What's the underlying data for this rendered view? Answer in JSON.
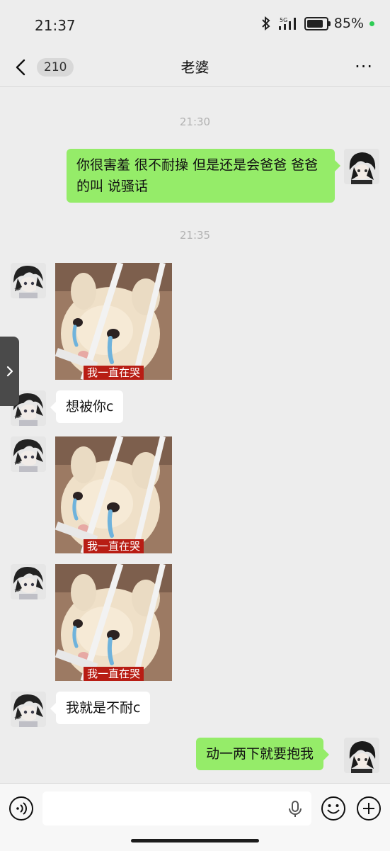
{
  "status": {
    "time": "21:37",
    "network": "5G",
    "battery_pct": 85,
    "battery_label": "85%"
  },
  "header": {
    "back_count": "210",
    "title": "老婆",
    "more": "···"
  },
  "messages": {
    "ts1": "21:30",
    "out1": "你很害羞 很不耐操 但是还是会爸爸 爸爸的叫 说骚话",
    "ts2": "21:35",
    "sticker_caption": "我一直在哭",
    "in1": "想被你c",
    "in2": "我就是不耐c",
    "out2": "动一两下就要抱我"
  },
  "input": {
    "placeholder": ""
  },
  "colors": {
    "bubble_out": "#95ec69",
    "bubble_in": "#ffffff",
    "background": "#ededed",
    "sticker_caption_bg": "#b81d14"
  }
}
